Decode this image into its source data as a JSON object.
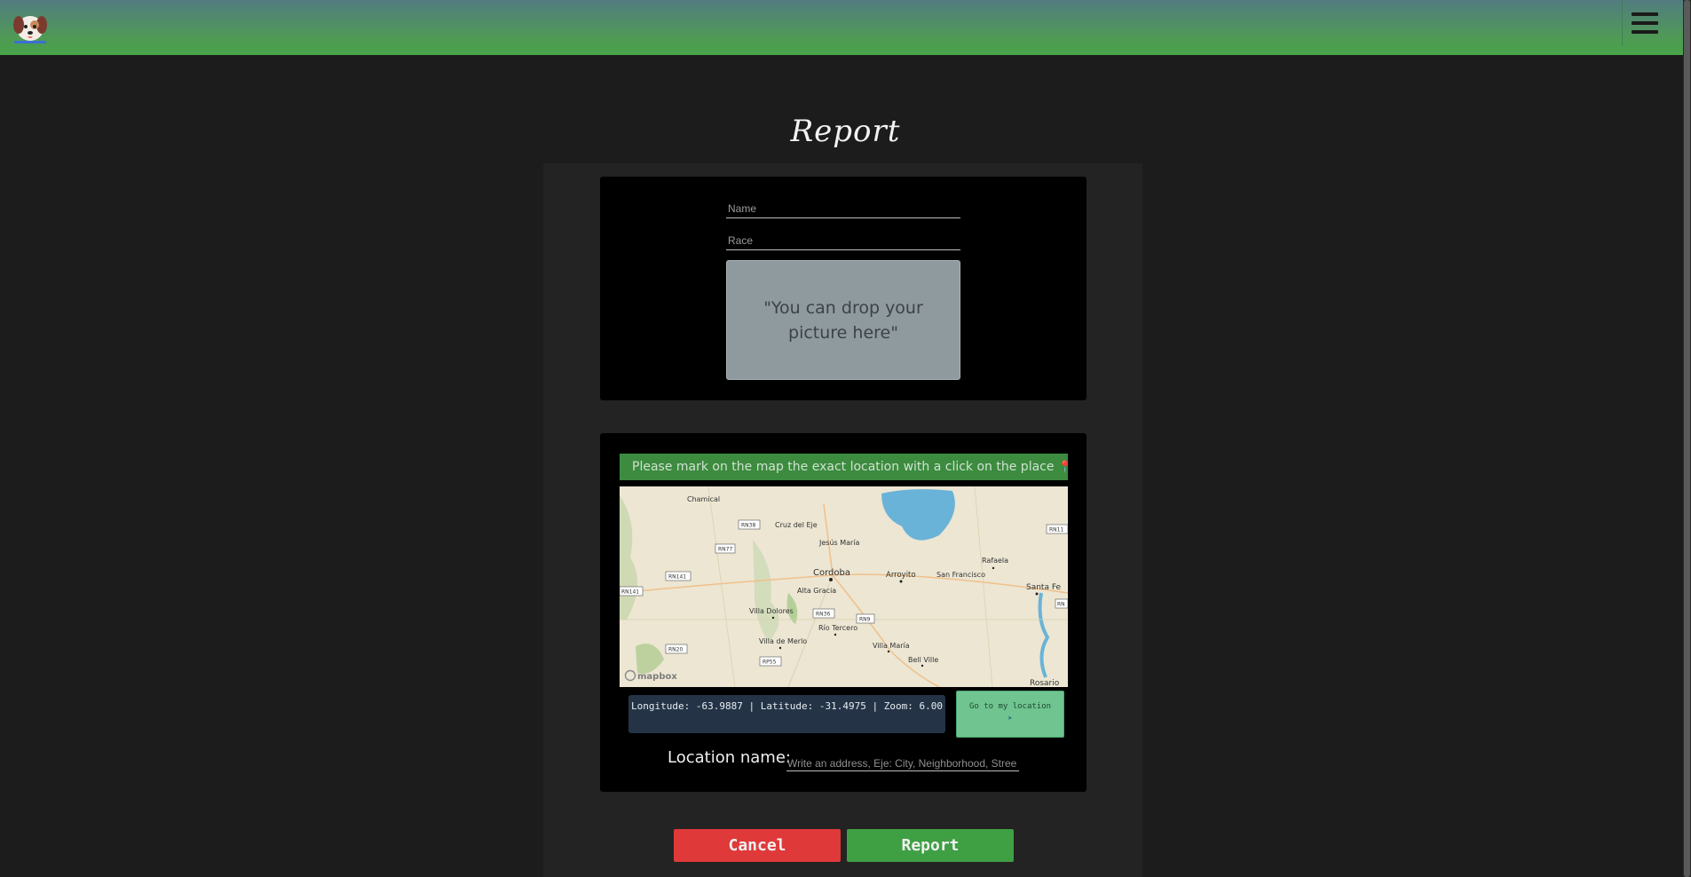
{
  "header": {
    "logo_icon": "dog-face-icon",
    "menu_icon": "hamburger-menu-icon",
    "gradient_top": "#527c80",
    "gradient_bottom": "#47a447"
  },
  "page": {
    "title": "Report"
  },
  "form": {
    "name_placeholder": "Name",
    "race_placeholder": "Race",
    "dropzone_text": "\"You can drop your picture here\""
  },
  "map_section": {
    "notice": "Please mark on the map the exact location with a click on the place",
    "notice_icon": "map-pin-icon",
    "coordinates_text": "Longitude: -63.9887 | Latitude: -31.4975 | Zoom: 6.00",
    "locate_button": "Go to my location",
    "locate_icon": "compass-icon",
    "attribution": "mapbox",
    "places": [
      "Chamical",
      "Cruz del Eje",
      "Jesús María",
      "Cordoba",
      "Arroyito",
      "San Francisco",
      "Rafaela",
      "Santa Fe",
      "Alta Gracia",
      "Villa Dolores",
      "Río Tercero",
      "Villa de Merlo",
      "Villa María",
      "Bell Ville",
      "Rosario"
    ],
    "roads": [
      "RN38",
      "RN77",
      "RN141",
      "RN141",
      "RN11",
      "RN36",
      "RN9",
      "RN20",
      "RP55",
      "RN"
    ],
    "location_label": "Location name:",
    "location_placeholder": "Write an address, Eje: City, Neighborhood, Stree"
  },
  "actions": {
    "cancel": "Cancel",
    "report": "Report",
    "cancel_color": "#e0393a",
    "report_color": "#3f9f43"
  }
}
